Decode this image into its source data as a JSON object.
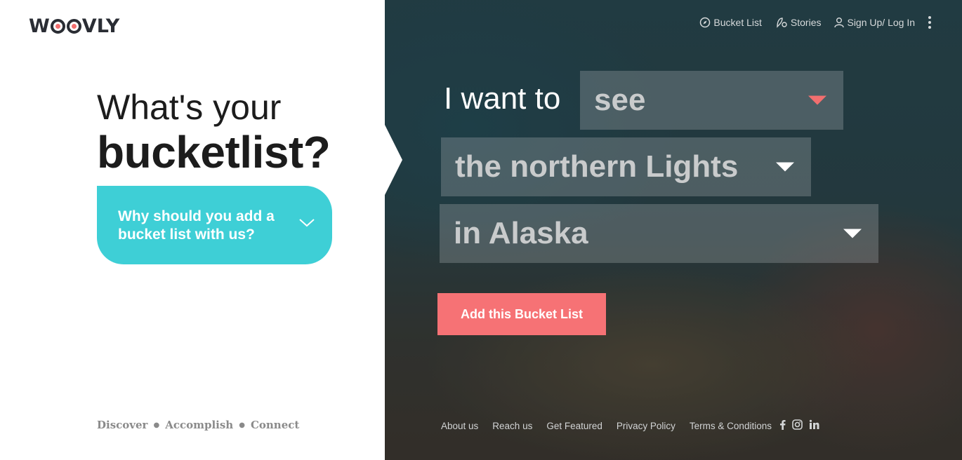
{
  "brand": {
    "logo_text_left": "W",
    "logo_text_right": "VLY",
    "logo_full": "WOOVLY"
  },
  "hero": {
    "line1": "What's your",
    "line2": "bucketlist?",
    "why_button": "Why should you add a bucket list with us?"
  },
  "left_footer": {
    "items": [
      "Discover",
      "Accomplish",
      "Connect"
    ]
  },
  "nav": {
    "bucket_list": "Bucket List",
    "stories": "Stories",
    "sign_in": "Sign Up/ Log In"
  },
  "form": {
    "prefix": "I want to",
    "verb": "see",
    "thing": "the northern Lights",
    "place": "in Alaska",
    "submit": "Add this Bucket List"
  },
  "right_footer": {
    "links": [
      "About us",
      "Reach us",
      "Get Featured",
      "Privacy Policy",
      "Terms & Conditions"
    ],
    "social": [
      "facebook-icon",
      "instagram-icon",
      "linkedin-icon"
    ]
  },
  "colors": {
    "accent_teal": "#3ecfd6",
    "accent_coral": "#f67275",
    "dark_text": "#1c1c1c"
  }
}
